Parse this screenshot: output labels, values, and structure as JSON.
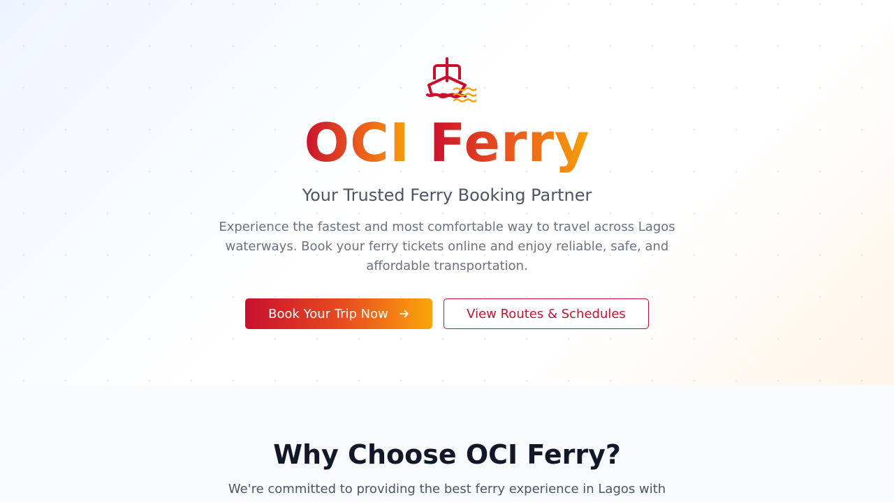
{
  "hero": {
    "icon": "ship-icon",
    "brand_part1": "OCI",
    "brand_part2": "Ferry",
    "tagline": "Your Trusted Ferry Booking Partner",
    "description": "Experience the fastest and most comfortable way to travel across Lagos waterways. Book your ferry tickets online and enjoy reliable, safe, and affordable transportation.",
    "primary_button": "Book Your Trip Now",
    "primary_button_icon": "arrow-right-icon",
    "secondary_button": "View Routes & Schedules"
  },
  "features": {
    "title": "Why Choose OCI Ferry?",
    "subtitle": "We're committed to providing the best ferry experience in Lagos with"
  },
  "colors": {
    "brand_red": "#c8102e",
    "brand_orange": "#f7a20a",
    "text_dark": "#111827",
    "text_muted": "#6b7280"
  }
}
